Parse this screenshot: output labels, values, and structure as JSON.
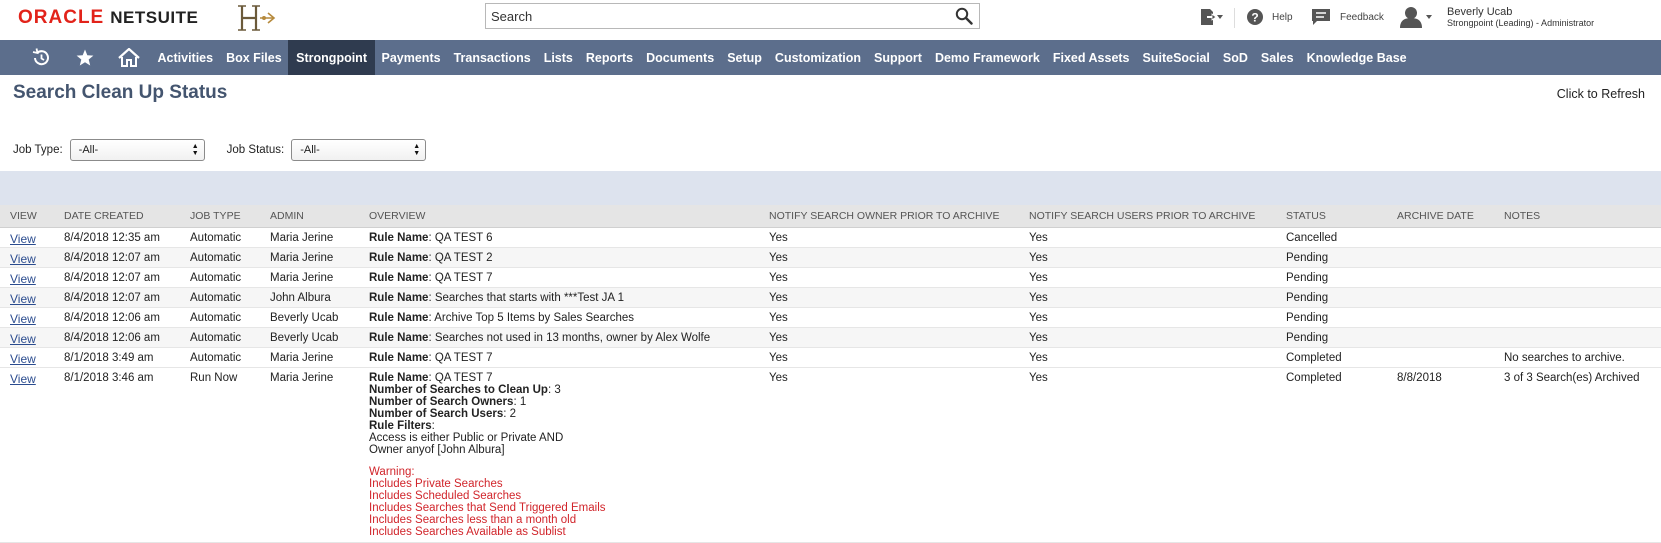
{
  "header": {
    "logo_oracle": "ORACLE",
    "logo_netsuite": "NETSUITE",
    "search_placeholder": "Search",
    "help_label": "Help",
    "feedback_label": "Feedback",
    "user_name": "Beverly Ucab",
    "user_role": "Strongpoint (Leading) - Administrator"
  },
  "nav": {
    "items": [
      "Activities",
      "Box Files",
      "Strongpoint",
      "Payments",
      "Transactions",
      "Lists",
      "Reports",
      "Documents",
      "Setup",
      "Customization",
      "Support",
      "Demo Framework",
      "Fixed Assets",
      "SuiteSocial",
      "SoD",
      "Sales",
      "Knowledge Base"
    ],
    "active": "Strongpoint"
  },
  "page": {
    "title": "Search Clean Up Status",
    "refresh_label": "Click to Refresh",
    "filters": {
      "job_type_label": "Job Type:",
      "job_type_value": "-All-",
      "job_status_label": "Job Status:",
      "job_status_value": "-All-"
    }
  },
  "table": {
    "columns": [
      "View",
      "Date Created",
      "Job Type",
      "Admin",
      "Overview",
      "Notify Search Owner Prior to Archive",
      "Notify Search Users Prior to Archive",
      "Status",
      "Archive Date",
      "Notes"
    ],
    "rows": [
      {
        "view": "View",
        "date": "8/4/2018 12:35 am",
        "job_type": "Automatic",
        "admin": "Maria Jerine",
        "rule_label": "Rule Name",
        "rule_name": ": QA TEST 6",
        "notify_owner": "Yes",
        "notify_users": "Yes",
        "status": "Cancelled",
        "archive_date": "",
        "notes": ""
      },
      {
        "view": "View",
        "date": "8/4/2018 12:07 am",
        "job_type": "Automatic",
        "admin": "Maria Jerine",
        "rule_label": "Rule Name",
        "rule_name": ": QA TEST 2",
        "notify_owner": "Yes",
        "notify_users": "Yes",
        "status": "Pending",
        "archive_date": "",
        "notes": ""
      },
      {
        "view": "View",
        "date": "8/4/2018 12:07 am",
        "job_type": "Automatic",
        "admin": "Maria Jerine",
        "rule_label": "Rule Name",
        "rule_name": ": QA TEST 7",
        "notify_owner": "Yes",
        "notify_users": "Yes",
        "status": "Pending",
        "archive_date": "",
        "notes": ""
      },
      {
        "view": "View",
        "date": "8/4/2018 12:07 am",
        "job_type": "Automatic",
        "admin": "John Albura",
        "rule_label": "Rule Name",
        "rule_name": ": Searches that starts with ***Test JA 1",
        "notify_owner": "Yes",
        "notify_users": "Yes",
        "status": "Pending",
        "archive_date": "",
        "notes": ""
      },
      {
        "view": "View",
        "date": "8/4/2018 12:06 am",
        "job_type": "Automatic",
        "admin": "Beverly Ucab",
        "rule_label": "Rule Name",
        "rule_name": ": Archive Top 5 Items by Sales Searches",
        "notify_owner": "Yes",
        "notify_users": "Yes",
        "status": "Pending",
        "archive_date": "",
        "notes": ""
      },
      {
        "view": "View",
        "date": "8/4/2018 12:06 am",
        "job_type": "Automatic",
        "admin": "Beverly Ucab",
        "rule_label": "Rule Name",
        "rule_name": ": Searches not used in 13 months, owner by Alex Wolfe",
        "notify_owner": "Yes",
        "notify_users": "Yes",
        "status": "Pending",
        "archive_date": "",
        "notes": ""
      },
      {
        "view": "View",
        "date": "8/1/2018 3:49 am",
        "job_type": "Automatic",
        "admin": "Maria Jerine",
        "rule_label": "Rule Name",
        "rule_name": ": QA TEST 7",
        "notify_owner": "Yes",
        "notify_users": "Yes",
        "status": "Completed",
        "archive_date": "",
        "notes": "No searches to archive."
      }
    ],
    "detail_row": {
      "view": "View",
      "date": "8/1/2018 3:46 am",
      "job_type": "Run Now",
      "admin": "Maria Jerine",
      "rule_label": "Rule Name",
      "rule_name": ": QA TEST 7",
      "searches_label": "Number of Searches to Clean Up",
      "searches_value": ": 3",
      "owners_label": "Number of Search Owners",
      "owners_value": ": 1",
      "users_label": "Number of Search Users",
      "users_value": ": 2",
      "filters_label": "Rule Filters",
      "filters_colon": ":",
      "filter_line_1": "Access is either Public or Private AND",
      "filter_line_2": "Owner anyof [John Albura]",
      "warning_lines": [
        "Warning:",
        "Includes Private Searches",
        "Includes Scheduled Searches",
        "Includes Searches that Send Triggered Emails",
        "Includes Searches less than a month old",
        "Includes Searches Available as Sublist"
      ],
      "notify_owner": "Yes",
      "notify_users": "Yes",
      "status": "Completed",
      "archive_date": "8/8/2018",
      "notes": "3 of 3 Search(es) Archived"
    }
  },
  "colors": {
    "nav_bg": "#5c6e8c",
    "nav_active": "#2f3b4f",
    "title": "#44556f",
    "warning": "#d1252b",
    "link": "#2b4c8f",
    "band": "#dde3ee"
  }
}
